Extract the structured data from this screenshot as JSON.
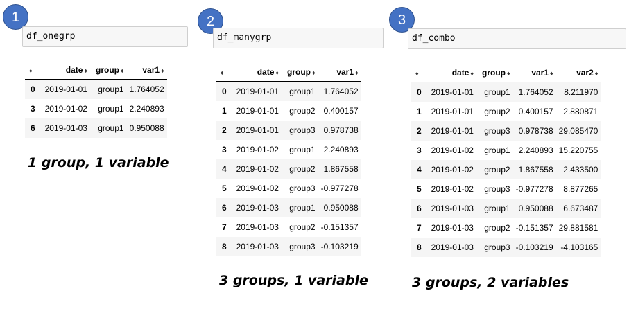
{
  "panels": [
    {
      "badge": "1",
      "cell_code": "df_onegrp",
      "caption": "1 group, 1 variable",
      "columns": [
        "date",
        "group",
        "var1"
      ],
      "rows": [
        {
          "idx": "0",
          "cells": [
            "2019-01-01",
            "group1",
            "1.764052"
          ]
        },
        {
          "idx": "3",
          "cells": [
            "2019-01-02",
            "group1",
            "2.240893"
          ]
        },
        {
          "idx": "6",
          "cells": [
            "2019-01-03",
            "group1",
            "0.950088"
          ]
        }
      ]
    },
    {
      "badge": "2",
      "cell_code": "df_manygrp",
      "caption": "3 groups, 1 variable",
      "columns": [
        "date",
        "group",
        "var1"
      ],
      "rows": [
        {
          "idx": "0",
          "cells": [
            "2019-01-01",
            "group1",
            "1.764052"
          ]
        },
        {
          "idx": "1",
          "cells": [
            "2019-01-01",
            "group2",
            "0.400157"
          ]
        },
        {
          "idx": "2",
          "cells": [
            "2019-01-01",
            "group3",
            "0.978738"
          ]
        },
        {
          "idx": "3",
          "cells": [
            "2019-01-02",
            "group1",
            "2.240893"
          ]
        },
        {
          "idx": "4",
          "cells": [
            "2019-01-02",
            "group2",
            "1.867558"
          ]
        },
        {
          "idx": "5",
          "cells": [
            "2019-01-02",
            "group3",
            "-0.977278"
          ]
        },
        {
          "idx": "6",
          "cells": [
            "2019-01-03",
            "group1",
            "0.950088"
          ]
        },
        {
          "idx": "7",
          "cells": [
            "2019-01-03",
            "group2",
            "-0.151357"
          ]
        },
        {
          "idx": "8",
          "cells": [
            "2019-01-03",
            "group3",
            "-0.103219"
          ]
        }
      ]
    },
    {
      "badge": "3",
      "cell_code": "df_combo",
      "caption": "3 groups, 2 variables",
      "columns": [
        "date",
        "group",
        "var1",
        "var2"
      ],
      "rows": [
        {
          "idx": "0",
          "cells": [
            "2019-01-01",
            "group1",
            "1.764052",
            "8.211970"
          ]
        },
        {
          "idx": "1",
          "cells": [
            "2019-01-01",
            "group2",
            "0.400157",
            "2.880871"
          ]
        },
        {
          "idx": "2",
          "cells": [
            "2019-01-01",
            "group3",
            "0.978738",
            "29.085470"
          ]
        },
        {
          "idx": "3",
          "cells": [
            "2019-01-02",
            "group1",
            "2.240893",
            "15.220755"
          ]
        },
        {
          "idx": "4",
          "cells": [
            "2019-01-02",
            "group2",
            "1.867558",
            "2.433500"
          ]
        },
        {
          "idx": "5",
          "cells": [
            "2019-01-02",
            "group3",
            "-0.977278",
            "8.877265"
          ]
        },
        {
          "idx": "6",
          "cells": [
            "2019-01-03",
            "group1",
            "0.950088",
            "6.673487"
          ]
        },
        {
          "idx": "7",
          "cells": [
            "2019-01-03",
            "group2",
            "-0.151357",
            "29.881581"
          ]
        },
        {
          "idx": "8",
          "cells": [
            "2019-01-03",
            "group3",
            "-0.103219",
            "-4.103165"
          ]
        }
      ]
    }
  ],
  "sort_icon": "sort-arrows-icon",
  "colors": {
    "badge_fill": "#4472c4",
    "code_cell_bg": "#f7f7f7",
    "row_stripe": "#f5f5f5"
  }
}
